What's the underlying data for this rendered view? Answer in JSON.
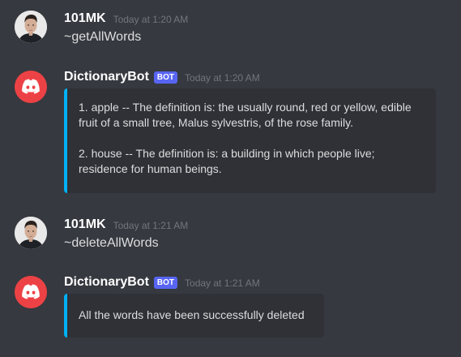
{
  "messages": [
    {
      "author": "101MK",
      "timestamp": "Today at 1:20 AM",
      "text": "~getAllWords"
    },
    {
      "author": "DictionaryBot",
      "bot_tag": "BOT",
      "timestamp": "Today at 1:20 AM",
      "embed": [
        "1. apple -- The definition is: the usually round, red or yellow, edible fruit of a small tree, Malus sylvestris, of the rose family.",
        "2. house -- The definition is: a building in which people live; residence for human beings."
      ]
    },
    {
      "author": "101MK",
      "timestamp": "Today at 1:21 AM",
      "text": "~deleteAllWords"
    },
    {
      "author": "DictionaryBot",
      "bot_tag": "BOT",
      "timestamp": "Today at 1:21 AM",
      "embed": [
        "All the words have been successfully deleted"
      ]
    }
  ],
  "colors": {
    "background": "#36393f",
    "embed_background": "#2f3136",
    "embed_accent": "#00b0f4",
    "bot_avatar": "#ed4245",
    "bot_tag": "#5865f2"
  },
  "icons": {
    "user_avatar": "user-portrait-avatar",
    "bot_avatar": "discord-logo-icon"
  }
}
